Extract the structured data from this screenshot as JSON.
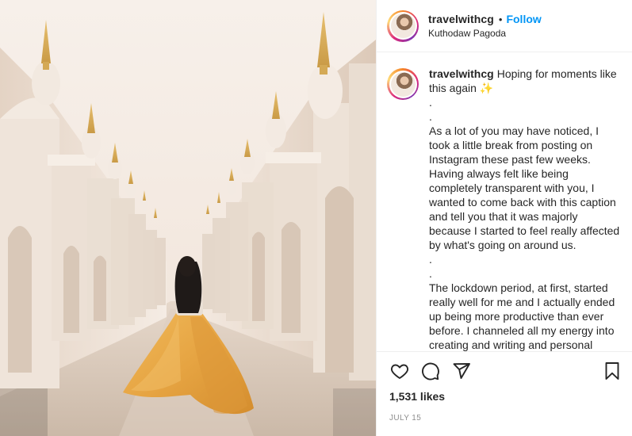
{
  "header": {
    "username": "travelwithcg",
    "separator": "•",
    "follow_label": "Follow",
    "location": "Kuthodaw Pagoda"
  },
  "caption": {
    "username": "travelwithcg",
    "first_text": "Hoping for moments like this again ✨",
    "lines": [
      ".",
      ".",
      "As a lot of you may have noticed, I took a little break from posting on Instagram these past few weeks. Having always felt like being completely transparent with you, I wanted to come back with this caption and tell you that it was majorly because I started to feel really affected by what's going on around us.",
      ".",
      ".",
      "The lockdown period, at first, started really well for me and I actually ended up being more productive than ever before. I channeled all my energy into creating and writing and personal"
    ]
  },
  "actions": {
    "like_icon": "heart-icon",
    "comment_icon": "comment-icon",
    "share_icon": "share-icon",
    "save_icon": "bookmark-icon",
    "likes": "1,531 likes",
    "date": "JULY 15"
  },
  "colors": {
    "follow": "#0095f6",
    "text": "#262626",
    "muted": "#8e8e8e",
    "skirt": "#e8a94a",
    "pagoda_white": "#f4ede6"
  }
}
